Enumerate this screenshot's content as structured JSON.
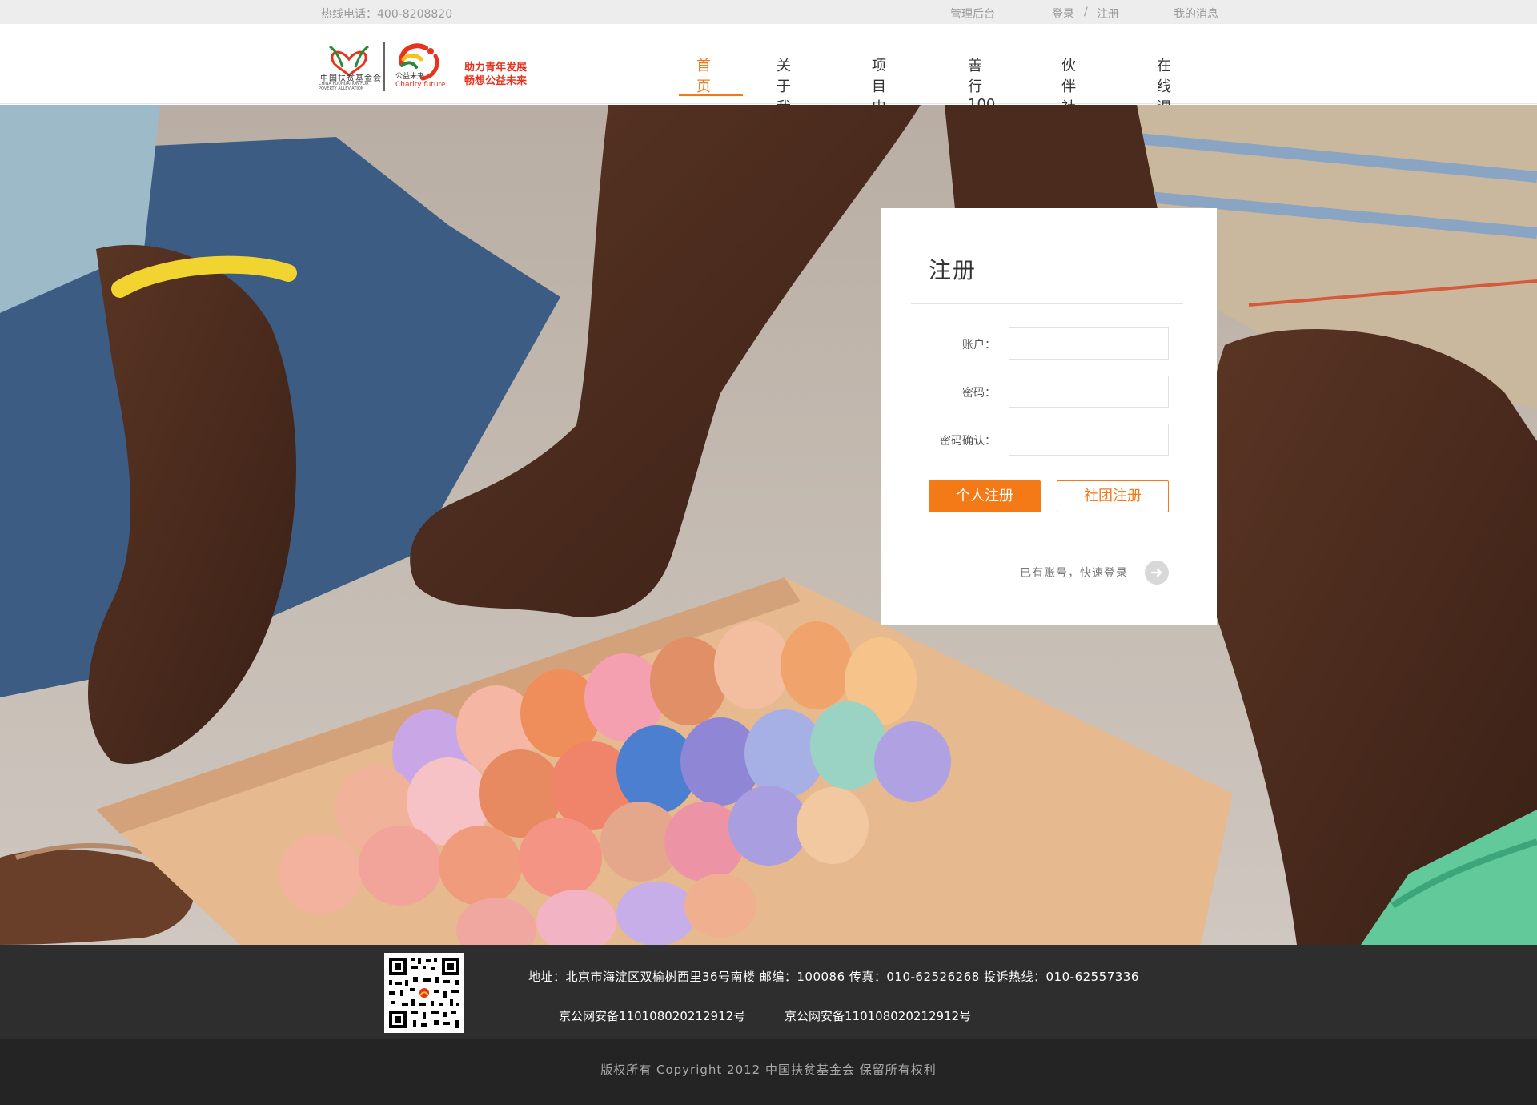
{
  "topbar": {
    "hotline": "热线电话：400-8208820",
    "admin": "管理后台",
    "login": "登录",
    "separator": "/",
    "register": "注册",
    "messages": "我的消息"
  },
  "logo": {
    "org_cn": "中国扶贫基金会",
    "org_en": "CHINA FOUNDATION FOR POVERTY ALLEVIATION",
    "brand_cn": "公益未来",
    "brand_en": "Charity future",
    "slogan_line1": "助力青年发展",
    "slogan_line2": "畅想公益未来"
  },
  "nav": {
    "items": [
      {
        "label": "首页",
        "active": true
      },
      {
        "label": "关于我们"
      },
      {
        "label": "项目申请"
      },
      {
        "label": "善行100"
      },
      {
        "label": "伙伴社团"
      },
      {
        "label": "在线课堂"
      }
    ]
  },
  "register": {
    "title": "注册",
    "account_label": "账户：",
    "password_label": "密码：",
    "confirm_label": "密码确认：",
    "account_value": "",
    "password_value": "",
    "confirm_value": "",
    "personal_button": "个人注册",
    "club_button": "社团注册",
    "quick_login": "已有账号，快速登录"
  },
  "footer": {
    "address": "地址：北京市海淀区双榆树西里36号南楼 邮编：100086 传真：010-62526268 投诉热线：010-62557336",
    "icp1": "京公网安备110108020212912号",
    "icp2": "京公网安备110108020212912号",
    "copyright": "版权所有 Copyright 2012 中国扶贫基金会 保留所有权利"
  },
  "colors": {
    "accent": "#f47a18",
    "footer_dark": "#2e2e2e",
    "footer_darker": "#242424"
  }
}
